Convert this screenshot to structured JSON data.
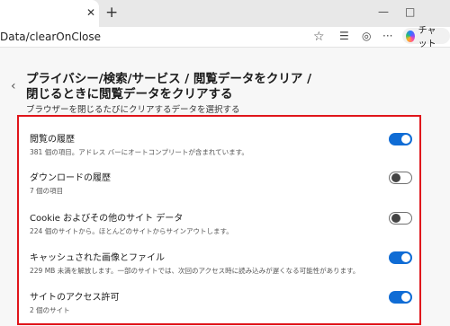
{
  "tab": {
    "close_icon": "close-icon",
    "new_tab_symbol": "+"
  },
  "window": {
    "minimize_symbol": "—",
    "maximize_symbol": "□"
  },
  "address_bar": {
    "url": "Data/clearOnClose"
  },
  "toolbar": {
    "copilot_label": "チャット",
    "more_symbol": "···"
  },
  "page": {
    "title": "プライバシー/検索/サービス / 閲覧データをクリア / 閉じるときに閲覧データをクリアする",
    "subtitle": "ブラウザーを閉じるたびにクリアするデータを選択する",
    "back_icon": "chevron-left-icon"
  },
  "settings": [
    {
      "title": "閲覧の履歴",
      "desc": "381 個の項目。アドレス バーにオートコンプリートが含まれています。",
      "enabled": true
    },
    {
      "title": "ダウンロードの履歴",
      "desc": "7 個の項目",
      "enabled": false
    },
    {
      "title": "Cookie およびその他のサイト データ",
      "desc": "224 個のサイトから。ほとんどのサイトからサインアウトします。",
      "enabled": false
    },
    {
      "title": "キャッシュされた画像とファイル",
      "desc": "229 MB 未満を解放します。一部のサイトでは、次回のアクセス時に読み込みが遅くなる可能性があります。",
      "enabled": true
    },
    {
      "title": "サイトのアクセス許可",
      "desc": "2 個のサイト",
      "enabled": true
    }
  ],
  "colors": {
    "accent": "#0f6cd5",
    "highlight_border": "#e0151b"
  }
}
